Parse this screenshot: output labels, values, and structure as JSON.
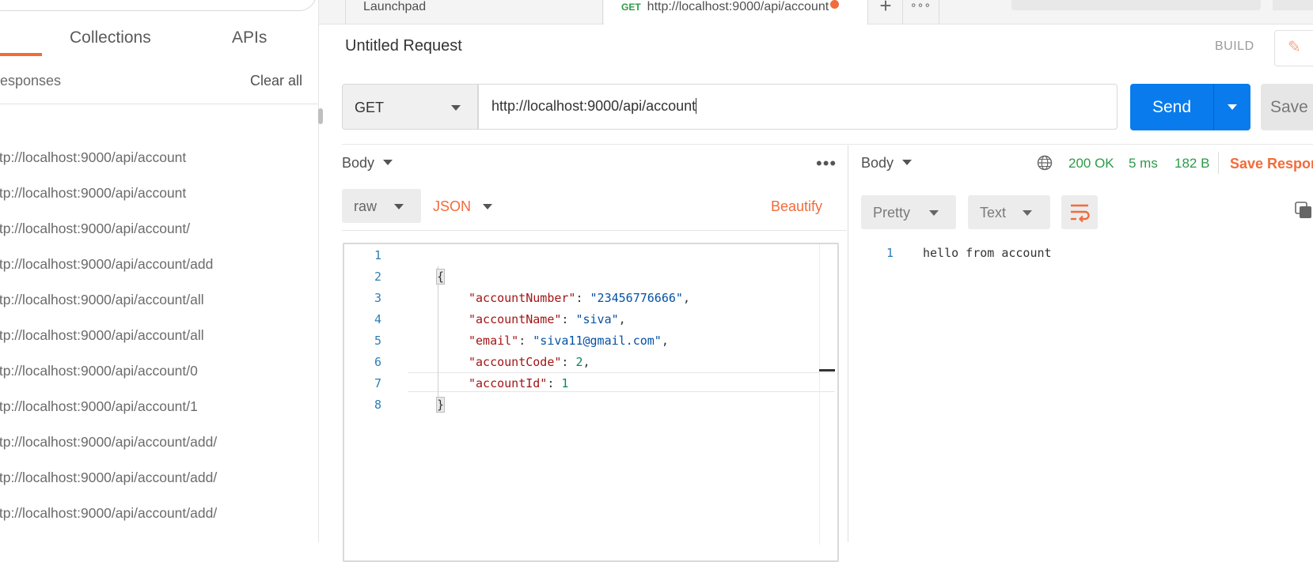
{
  "sidebar": {
    "tabs": [
      "Collections",
      "APIs"
    ],
    "responses_label": "esponses",
    "clear_all": "Clear all",
    "history": [
      "ttp://localhost:9000/api/account",
      "ttp://localhost:9000/api/account",
      "ttp://localhost:9000/api/account/",
      "ttp://localhost:9000/api/account/add",
      "ttp://localhost:9000/api/account/all",
      "ttp://localhost:9000/api/account/all",
      "ttp://localhost:9000/api/account/0",
      "ttp://localhost:9000/api/account/1",
      "ttp://localhost:9000/api/account/add/",
      "ttp://localhost:9000/api/account/add/",
      "ttp://localhost:9000/api/account/add/"
    ]
  },
  "tabs": {
    "launchpad": "Launchpad",
    "active_method": "GET",
    "active_url": "http://localhost:9000/api/account",
    "new_tab": "+",
    "more": "∘∘∘"
  },
  "request": {
    "title": "Untitled Request",
    "build_label": "BUILD",
    "method": "GET",
    "url": "http://localhost:9000/api/account",
    "send_label": "Send",
    "save_label": "Save",
    "body_label": "Body",
    "more_label": "•••",
    "body_mode": "raw",
    "body_type": "JSON",
    "beautify_label": "Beautify",
    "line_numbers": [
      "1",
      "2",
      "3",
      "4",
      "5",
      "6",
      "7",
      "8"
    ],
    "code": {
      "open_brace": "{",
      "close_brace": "}",
      "l3_key": "\"accountNumber\"",
      "l3_val": "\"23456776666\"",
      "l4_key": "\"accountName\"",
      "l4_val": "\"siva\"",
      "l5_key": "\"email\"",
      "l5_val": "\"siva11@gmail.com\"",
      "l6_key": "\"accountCode\"",
      "l6_val": "2",
      "l7_key": "\"accountId\"",
      "l7_val": "1",
      "colon": ": ",
      "comma": ","
    }
  },
  "response": {
    "body_label": "Body",
    "status": "200 OK",
    "time": "5 ms",
    "size": "182 B",
    "save_response": "Save Respor",
    "format": "Pretty",
    "view": "Text",
    "line_number": "1",
    "body_text": "hello from account"
  },
  "colors": {
    "accent": "#f26b3a",
    "send_blue": "#097bed",
    "status_green": "#2e9b47"
  }
}
